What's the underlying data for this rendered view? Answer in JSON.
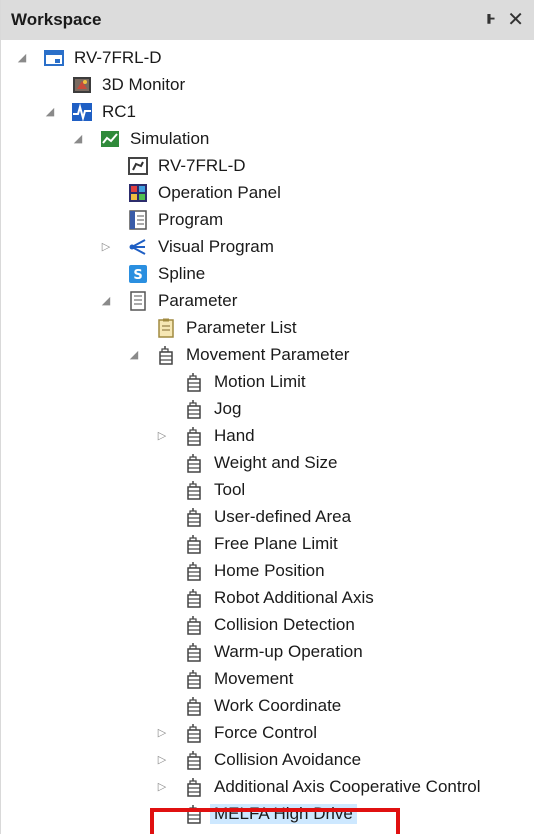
{
  "header": {
    "title": "Workspace",
    "pin_glyph": "ͱ",
    "close_glyph": "✕"
  },
  "tree": {
    "rc_device": "RV-7FRL-D",
    "monitor": "3D Monitor",
    "controller": "RC1",
    "simulation": "Simulation",
    "robot": "RV-7FRL-D",
    "operation_panel": "Operation Panel",
    "program": "Program",
    "visual_program": "Visual Program",
    "spline": "Spline",
    "parameter": "Parameter",
    "parameter_list": "Parameter List",
    "movement_parameter": "Movement Parameter",
    "motion_limit": "Motion Limit",
    "jog": "Jog",
    "hand": "Hand",
    "weight_and_size": "Weight and Size",
    "tool": "Tool",
    "user_defined_area": "User-defined Area",
    "free_plane_limit": "Free Plane Limit",
    "home_position": "Home Position",
    "robot_additional_axis": "Robot Additional Axis",
    "collision_detection": "Collision Detection",
    "warm_up_operation": "Warm-up Operation",
    "movement": "Movement",
    "work_coordinate": "Work Coordinate",
    "force_control": "Force Control",
    "collision_avoidance": "Collision Avoidance",
    "additional_axis_cooperative_control": "Additional Axis Cooperative Control",
    "melfa_high_drive": "MELFA High Drive"
  },
  "icons": {
    "expanded_glyph": "◢",
    "collapsed_glyph": "▷"
  },
  "colors": {
    "highlight": "#e01010",
    "header_bg": "#dcdcdc"
  }
}
